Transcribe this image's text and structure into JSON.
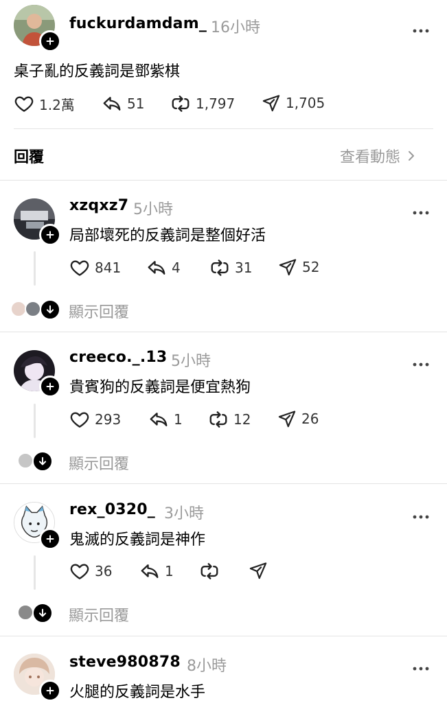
{
  "post": {
    "username": "fuckurdamdam_",
    "time": "16小時",
    "text": "桌子亂的反義詞是鄧紫棋",
    "likes": "1.2萬",
    "replies": "51",
    "reposts": "1,797",
    "shares": "1,705"
  },
  "replies_header": {
    "label": "回覆",
    "view_activity": "查看動態"
  },
  "comments": [
    {
      "username": "xzqxz7",
      "time": "5小時",
      "text": "局部壞死的反義詞是整個好活",
      "likes": "841",
      "replies": "4",
      "reposts": "31",
      "shares": "52",
      "show_replies": "顯示回覆"
    },
    {
      "username": "creeco._.13",
      "time": "5小時",
      "text": "貴賓狗的反義詞是便宜熱狗",
      "likes": "293",
      "replies": "1",
      "reposts": "12",
      "shares": "26",
      "show_replies": "顯示回覆"
    },
    {
      "username": "rex_0320_",
      "time": "3小時",
      "text": "鬼滅的反義詞是神作",
      "likes": "36",
      "replies": "1",
      "reposts": "",
      "shares": "",
      "show_replies": "顯示回覆"
    },
    {
      "username": "steve980878",
      "time": "8小時",
      "text": "火腿的反義詞是水手"
    }
  ],
  "colors": {
    "muted": "#9a9a9a",
    "divider": "#e3e3e3",
    "text": "#000000"
  },
  "icons": [
    "heart-icon",
    "reply-icon",
    "repost-icon",
    "share-icon",
    "more-icon",
    "plus-icon",
    "chevron-right-icon",
    "arrow-down-icon"
  ]
}
